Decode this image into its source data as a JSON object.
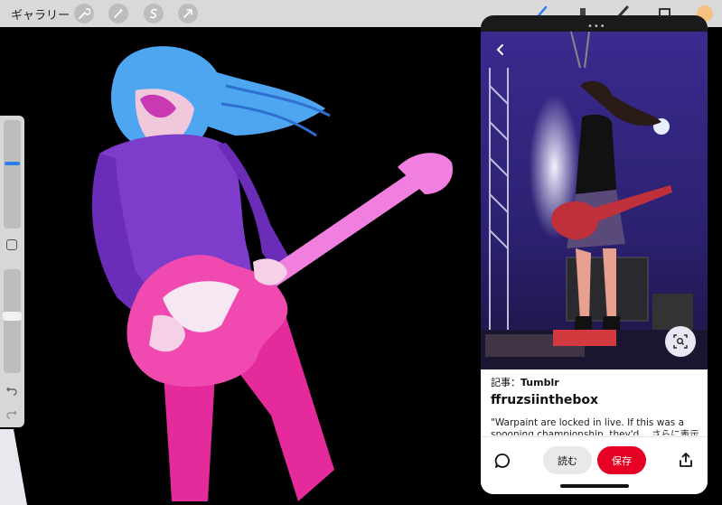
{
  "toolbar": {
    "gallery_label": "ギャラリー",
    "tools": [
      "wrench-icon",
      "magic-wand-icon",
      "selection-icon",
      "transform-arrow-icon"
    ],
    "right_tools": [
      "brush-icon",
      "smudge-icon",
      "eraser-icon",
      "layers-icon",
      "color-swatch"
    ]
  },
  "sidebar": {
    "brush_size_level": 0.6,
    "opacity_level": 0.55
  },
  "pin": {
    "source_prefix": "記事：",
    "source_name": "Tumblr",
    "title": "ffruzsiinthebox",
    "description": "\"Warpaint are locked in live. If this was a spooning championship, they'd… さらに表示",
    "read_label": "読む",
    "save_label": "保存"
  },
  "colors": {
    "save_red": "#e60023",
    "brush_blue": "#2f7cf6"
  }
}
